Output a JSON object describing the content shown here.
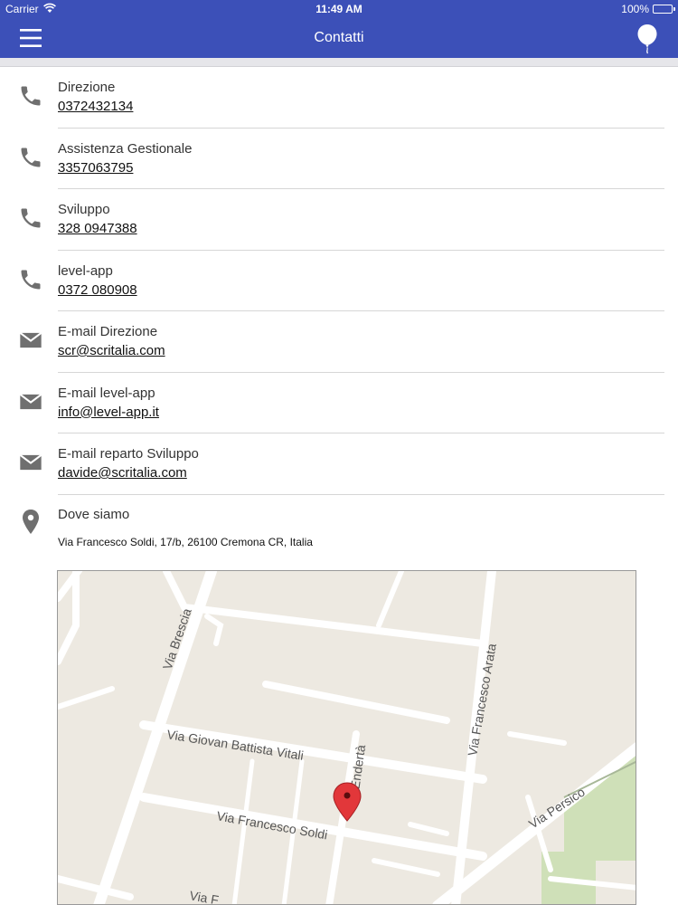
{
  "status_bar": {
    "carrier": "Carrier",
    "time": "11:49 AM",
    "battery": "100%"
  },
  "nav": {
    "title": "Contatti",
    "menu_icon": "hamburger-menu-icon",
    "right_icon": "balloon-icon",
    "bar_color": "#3c50b8"
  },
  "contacts": [
    {
      "label": "Direzione",
      "value": "0372432134",
      "icon": "phone-icon"
    },
    {
      "label": "Assistenza Gestionale",
      "value": "3357063795",
      "icon": "phone-icon"
    },
    {
      "label": "Sviluppo",
      "value": "328 0947388",
      "icon": "phone-icon"
    },
    {
      "label": "level-app",
      "value": "0372 080908",
      "icon": "phone-icon"
    },
    {
      "label": "E-mail Direzione",
      "value": "scr@scritalia.com",
      "icon": "mail-icon"
    },
    {
      "label": "E-mail level-app",
      "value": "info@level-app.it",
      "icon": "mail-icon"
    },
    {
      "label": "E-mail reparto Sviluppo",
      "value": "davide@scritalia.com",
      "icon": "mail-icon"
    }
  ],
  "location": {
    "label": "Dove siamo",
    "address": "Via Francesco Soldi, 17/b, 26100 Cremona CR, Italia",
    "icon": "location-pin-icon"
  },
  "map": {
    "streets": {
      "brescia": "Via Brescia",
      "vitali": "Via Giovan Battista Vitali",
      "arata": "Via Francesco Arata",
      "enderta": "Via Endertà",
      "soldi": "Via Francesco Soldi",
      "persico": "Via Persico",
      "bottom": "Via F"
    },
    "marker_color": "#e2373a"
  }
}
